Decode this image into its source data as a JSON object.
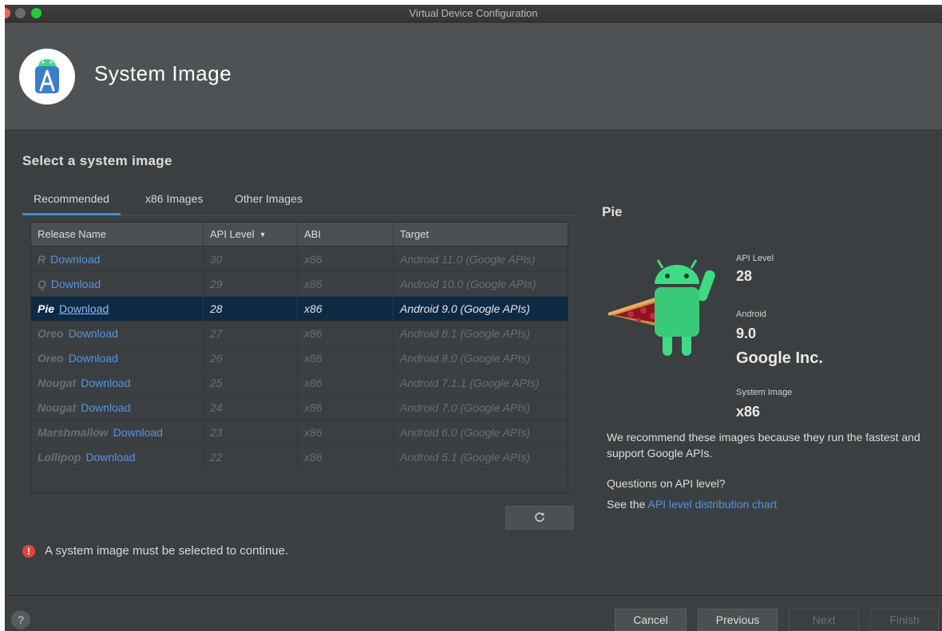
{
  "window": {
    "title": "Virtual Device Configuration"
  },
  "header": {
    "title": "System Image",
    "logo_icon": "android-studio-icon"
  },
  "section_title": "Select a system image",
  "tabs": [
    {
      "label": "Recommended",
      "active": true
    },
    {
      "label": "x86 Images",
      "active": false
    },
    {
      "label": "Other Images",
      "active": false
    }
  ],
  "table": {
    "columns": [
      "Release Name",
      "API Level",
      "ABI",
      "Target"
    ],
    "sort_indicator": "▼",
    "rows": [
      {
        "name": "R",
        "download": "Download",
        "api": "30",
        "abi": "x86",
        "target": "Android 11.0 (Google APIs)",
        "selected": false
      },
      {
        "name": "Q",
        "download": "Download",
        "api": "29",
        "abi": "x86",
        "target": "Android 10.0 (Google APIs)",
        "selected": false
      },
      {
        "name": "Pie",
        "download": "Download",
        "api": "28",
        "abi": "x86",
        "target": "Android 9.0 (Google APIs)",
        "selected": true
      },
      {
        "name": "Oreo",
        "download": "Download",
        "api": "27",
        "abi": "x86",
        "target": "Android 8.1 (Google APIs)",
        "selected": false
      },
      {
        "name": "Oreo",
        "download": "Download",
        "api": "26",
        "abi": "x86",
        "target": "Android 8.0 (Google APIs)",
        "selected": false
      },
      {
        "name": "Nougat",
        "download": "Download",
        "api": "25",
        "abi": "x86",
        "target": "Android 7.1.1 (Google APIs)",
        "selected": false
      },
      {
        "name": "Nougat",
        "download": "Download",
        "api": "24",
        "abi": "x86",
        "target": "Android 7.0 (Google APIs)",
        "selected": false
      },
      {
        "name": "Marshmallow",
        "download": "Download",
        "api": "23",
        "abi": "x86",
        "target": "Android 6.0 (Google APIs)",
        "selected": false
      },
      {
        "name": "Lollipop",
        "download": "Download",
        "api": "22",
        "abi": "x86",
        "target": "Android 5.1 (Google APIs)",
        "selected": false
      }
    ]
  },
  "refresh_icon": "refresh-icon",
  "error": {
    "icon": "error-icon",
    "glyph": "!",
    "message": "A system image must be selected to continue."
  },
  "detail": {
    "title": "Pie",
    "api_level_label": "API Level",
    "api_level": "28",
    "android_label": "Android",
    "android_version": "9.0",
    "vendor": "Google Inc.",
    "system_image_label": "System Image",
    "system_image": "x86",
    "recommend_text": "We recommend these images because they run the fastest and support Google APIs.",
    "questions": "Questions on API level?",
    "see_prefix": "See the ",
    "chart_link": "API level distribution chart"
  },
  "footer": {
    "help_label": "?",
    "cancel": "Cancel",
    "previous": "Previous",
    "next": "Next",
    "finish": "Finish"
  },
  "colors": {
    "accent": "#4a88c7",
    "link": "#5294e2",
    "selection": "#0d2a45",
    "error": "#e0443e"
  }
}
